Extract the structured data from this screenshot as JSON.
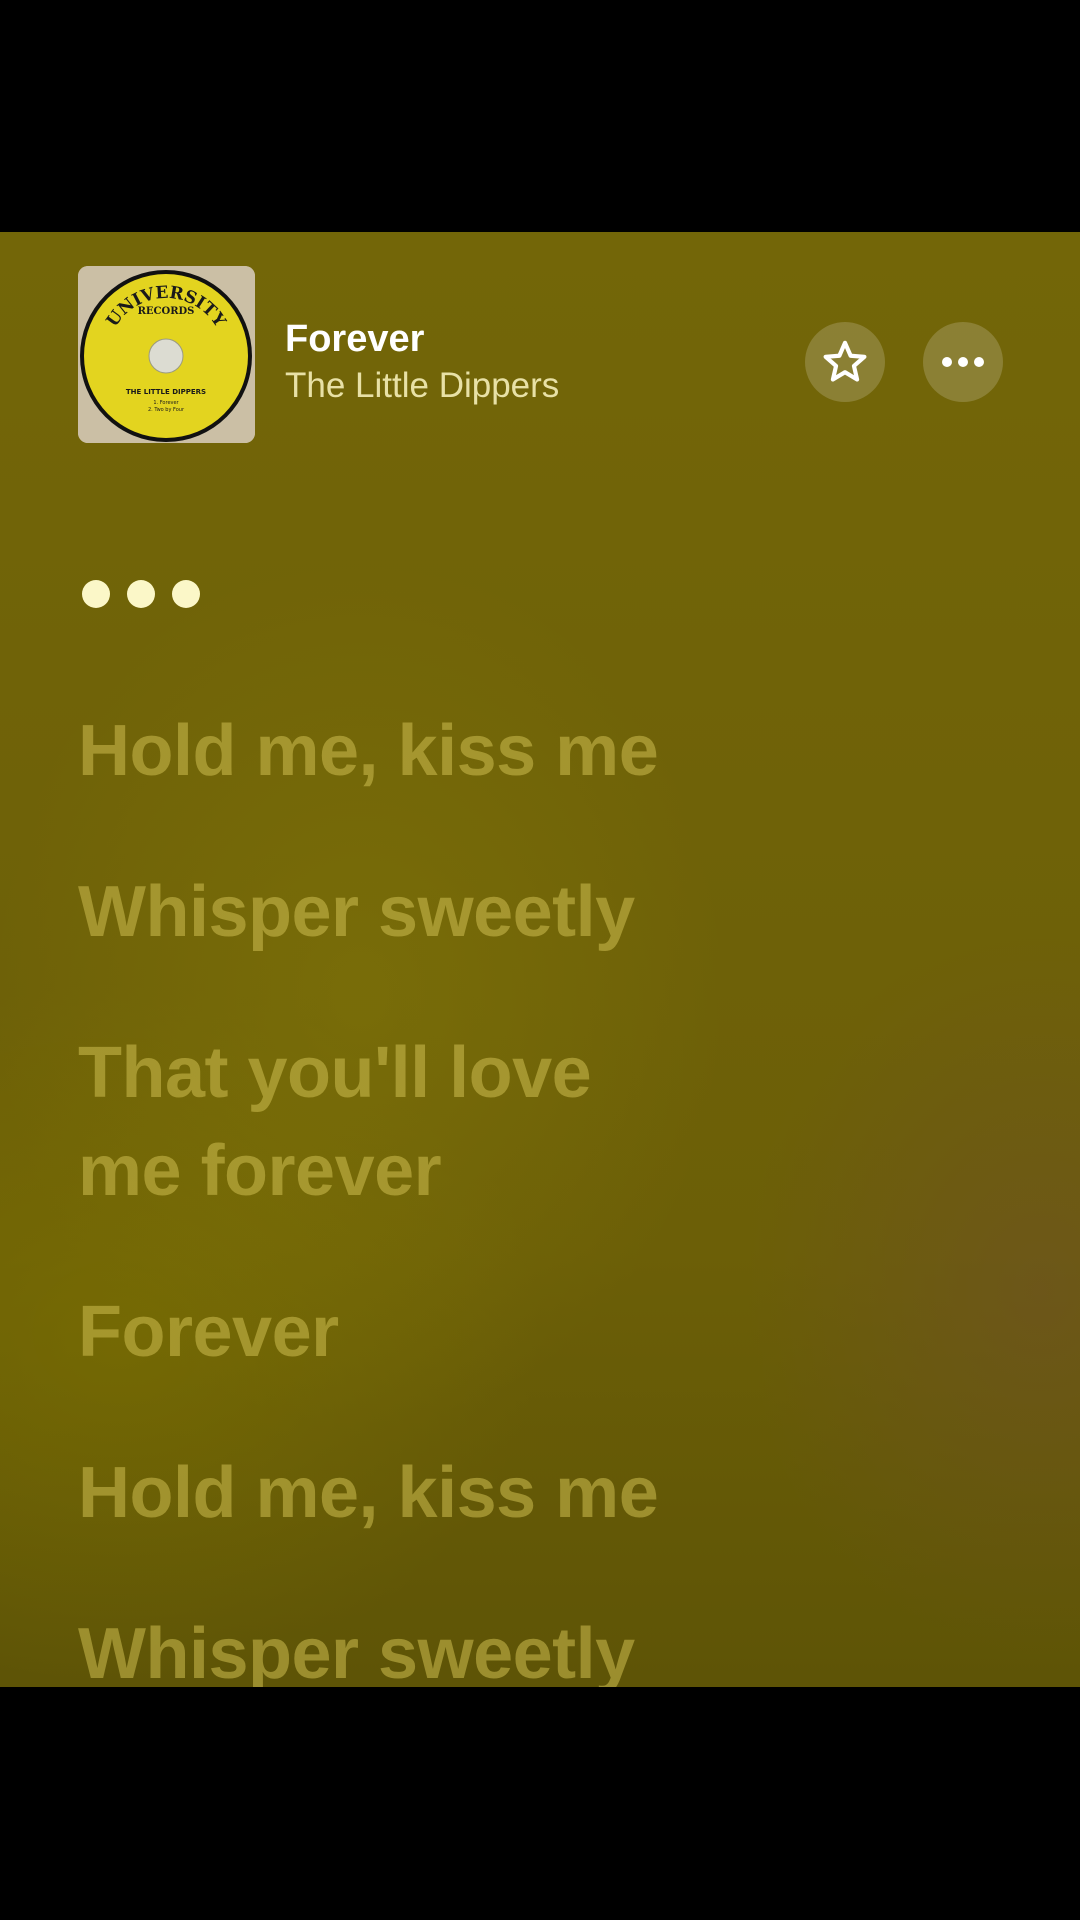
{
  "now_playing": {
    "title": "Forever",
    "artist": "The Little Dippers"
  },
  "album_art": {
    "label_top": "UNIVERSITY",
    "label_sub": "RECORDS",
    "label_artist": "THE LITTLE DIPPERS",
    "track_1": "1. Forever",
    "track_2": "2. Two by Four",
    "label_color": "#e3d41f"
  },
  "controls": {
    "favorite_icon": "star-outline-icon",
    "more_icon": "ellipsis-icon"
  },
  "lyrics": [
    "Hold me, kiss me",
    "Whisper sweetly",
    "That you'll love me forever",
    "Forever",
    "Hold me, kiss me",
    "Whisper sweetly"
  ],
  "colors": {
    "background": "#736608",
    "lyric_inactive": "#cdbe50",
    "dots": "#fbf7c8"
  }
}
